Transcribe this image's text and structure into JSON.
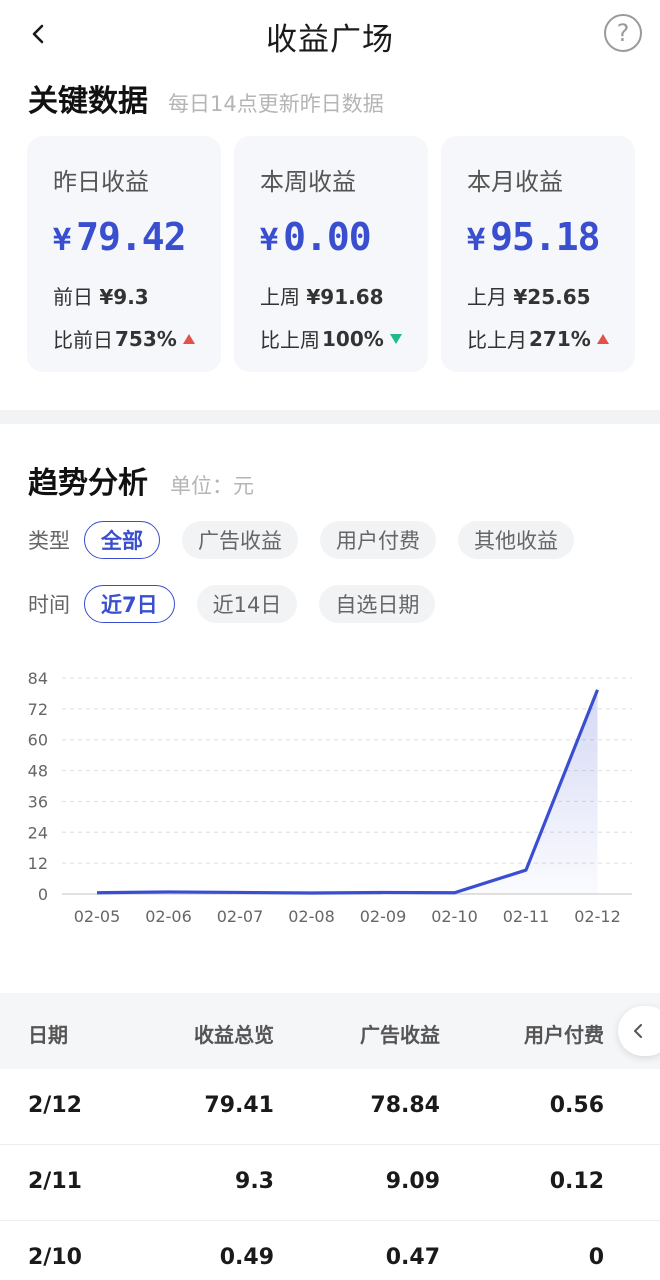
{
  "header": {
    "title": "收益广场",
    "help": "?"
  },
  "key_data": {
    "title": "关键数据",
    "subtitle": "每日14点更新昨日数据",
    "cards": [
      {
        "label": "昨日收益",
        "currency": "¥",
        "value": "79.42",
        "prev_label": "前日",
        "prev_value": "¥9.3",
        "ratio_label": "比前日",
        "ratio_value": "753%",
        "trend": "up"
      },
      {
        "label": "本周收益",
        "currency": "¥",
        "value": "0.00",
        "prev_label": "上周",
        "prev_value": "¥91.68",
        "ratio_label": "比上周",
        "ratio_value": "100%",
        "trend": "down"
      },
      {
        "label": "本月收益",
        "currency": "¥",
        "value": "95.18",
        "prev_label": "上月",
        "prev_value": "¥25.65",
        "ratio_label": "比上月",
        "ratio_value": "271%",
        "trend": "up"
      }
    ]
  },
  "trend": {
    "title": "趋势分析",
    "unit": "单位：元",
    "type_label": "类型",
    "type_options": [
      "全部",
      "广告收益",
      "用户付费",
      "其他收益"
    ],
    "type_selected": 0,
    "time_label": "时间",
    "time_options": [
      "近7日",
      "近14日",
      "自选日期"
    ],
    "time_selected": 0
  },
  "chart_data": {
    "type": "area",
    "x": [
      "02-05",
      "02-06",
      "02-07",
      "02-08",
      "02-09",
      "02-10",
      "02-11",
      "02-12"
    ],
    "series": [
      {
        "values": [
          0.5,
          0.8,
          0.6,
          0.4,
          0.6,
          0.49,
          9.3,
          79.41
        ]
      }
    ],
    "yticks": [
      0,
      12,
      24,
      36,
      48,
      60,
      72,
      84
    ],
    "ylim": [
      0,
      84
    ],
    "grid": true,
    "line_color": "#3a4fcf"
  },
  "table": {
    "columns": [
      "日期",
      "收益总览",
      "广告收益",
      "用户付费"
    ],
    "rows": [
      [
        "2/12",
        "79.41",
        "78.84",
        "0.56"
      ],
      [
        "2/11",
        "9.3",
        "9.09",
        "0.12"
      ],
      [
        "2/10",
        "0.49",
        "0.47",
        "0"
      ]
    ]
  },
  "colors": {
    "accent": "#3a4fcf",
    "up": "#e4504a",
    "down": "#1fb98d"
  }
}
